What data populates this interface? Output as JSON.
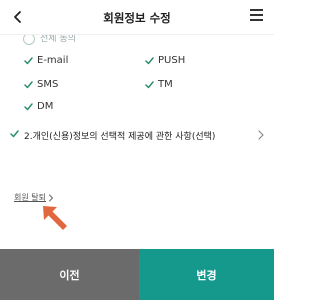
{
  "header": {
    "title": "회원정보 수정"
  },
  "partial_item": {
    "label": "전체 동의"
  },
  "options": [
    {
      "label": "E-mail",
      "checked": true
    },
    {
      "label": "PUSH",
      "checked": true
    },
    {
      "label": "SMS",
      "checked": true
    },
    {
      "label": "TM",
      "checked": true
    },
    {
      "label": "DM",
      "checked": true
    }
  ],
  "section": {
    "label": "2.개인(신용)정보의 선택적 제공에 관한 사항(선택)",
    "checked": true
  },
  "withdraw": {
    "label": "회원 탈퇴"
  },
  "buttons": {
    "prev_label": "이전",
    "change_label": "변경"
  },
  "colors": {
    "accent": "#16998d",
    "check": "#2e8f6a",
    "arrow": "#e0683f",
    "prev_bg": "#6b6b6b"
  }
}
